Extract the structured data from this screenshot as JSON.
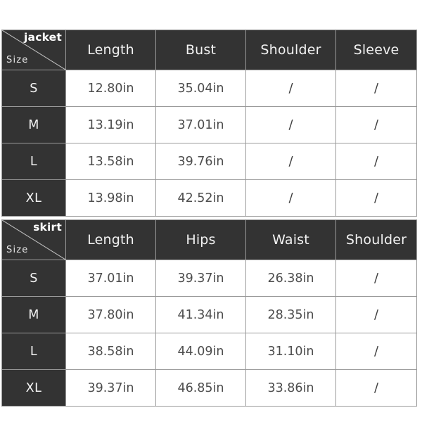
{
  "tables": [
    {
      "category": "jacket",
      "size_label": "Size",
      "columns": [
        "Length",
        "Bust",
        "Shoulder",
        "Sleeve"
      ],
      "rows": [
        {
          "size": "S",
          "values": [
            "12.80in",
            "35.04in",
            "/",
            "/"
          ]
        },
        {
          "size": "M",
          "values": [
            "13.19in",
            "37.01in",
            "/",
            "/"
          ]
        },
        {
          "size": "L",
          "values": [
            "13.58in",
            "39.76in",
            "/",
            "/"
          ]
        },
        {
          "size": "XL",
          "values": [
            "13.98in",
            "42.52in",
            "/",
            "/"
          ]
        }
      ]
    },
    {
      "category": "skirt",
      "size_label": "Size",
      "columns": [
        "Length",
        "Hips",
        "Waist",
        "Shoulder"
      ],
      "rows": [
        {
          "size": "S",
          "values": [
            "37.01in",
            "39.37in",
            "26.38in",
            "/"
          ]
        },
        {
          "size": "M",
          "values": [
            "37.80in",
            "41.34in",
            "28.35in",
            "/"
          ]
        },
        {
          "size": "L",
          "values": [
            "38.58in",
            "44.09in",
            "31.10in",
            "/"
          ]
        },
        {
          "size": "XL",
          "values": [
            "39.37in",
            "46.85in",
            "33.86in",
            "/"
          ]
        }
      ]
    }
  ],
  "colors": {
    "header_bg": "#333333",
    "header_text": "#f2f2f2",
    "cell_bg": "#ffffff",
    "cell_text": "#4d4d4d",
    "gridline": "#9a9a9a",
    "page_bg": "#ffffff"
  }
}
